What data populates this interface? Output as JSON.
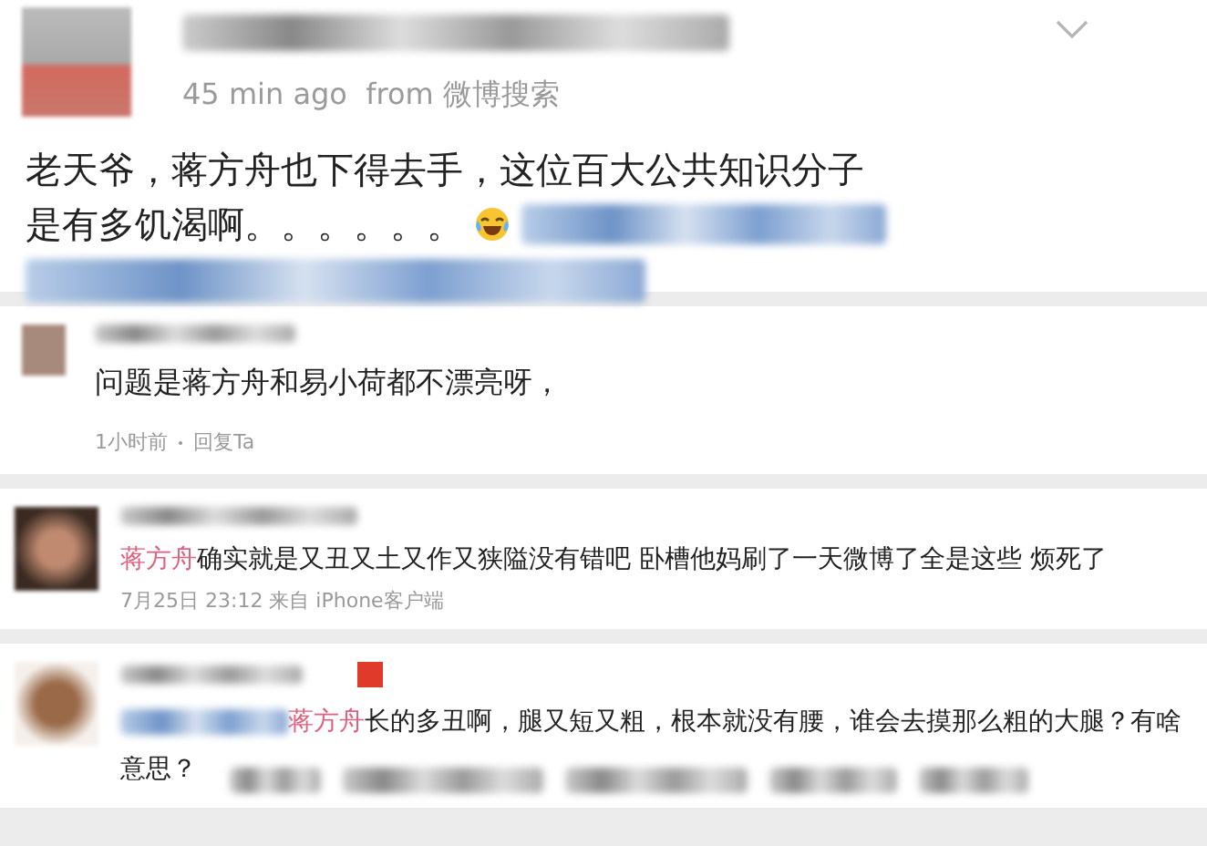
{
  "posts": [
    {
      "kind": "post",
      "meta": "45 min ago  from 微博搜索",
      "lines": [
        "老天爷，蒋方舟也下得去手，这位百大公共知识分子",
        "是有多饥渴啊。。。。。。"
      ]
    },
    {
      "kind": "reply",
      "text": "问题是蒋方舟和易小荷都不漂亮呀，",
      "time": "1小时前",
      "action": "回复Ta"
    },
    {
      "kind": "comment",
      "mention": "蒋方舟",
      "text": "确实就是又丑又土又作又狭隘没有错吧 卧槽他妈刷了一天微博了全是这些 烦死了",
      "meta": "7月25日 23:12 来自 iPhone客户端"
    },
    {
      "kind": "comment",
      "mention": "蒋方舟",
      "text": "长的多丑啊，腿又短又粗，根本就没有腰，谁会去摸那么粗的大腿？有啥意思？"
    }
  ]
}
